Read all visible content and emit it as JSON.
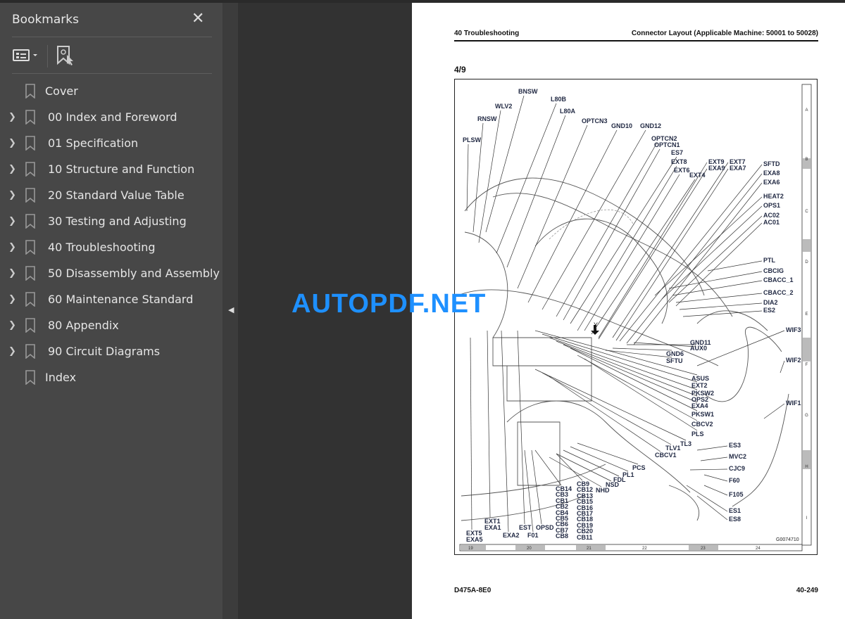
{
  "sidebar": {
    "title": "Bookmarks",
    "close_icon": "close-icon",
    "items": [
      {
        "label": "Cover",
        "expandable": false
      },
      {
        "label": "00 Index and Foreword",
        "expandable": true
      },
      {
        "label": "01 Specification",
        "expandable": true
      },
      {
        "label": "10 Structure and Function",
        "expandable": true
      },
      {
        "label": "20 Standard Value Table",
        "expandable": true
      },
      {
        "label": "30 Testing and Adjusting",
        "expandable": true
      },
      {
        "label": "40 Troubleshooting",
        "expandable": true
      },
      {
        "label": "50 Disassembly and Assembly",
        "expandable": true
      },
      {
        "label": "60 Maintenance Standard",
        "expandable": true
      },
      {
        "label": "80 Appendix",
        "expandable": true
      },
      {
        "label": "90 Circuit Diagrams",
        "expandable": true
      },
      {
        "label": "Index",
        "expandable": false
      }
    ]
  },
  "page": {
    "header_left": "40 Troubleshooting",
    "header_right": "Connector Layout (Applicable Machine: 50001 to 50028)",
    "page_fraction": "4/9",
    "figure_id": "G0074710",
    "view_marker": "Y",
    "footer_left": "D475A-8E0",
    "footer_right": "40-249",
    "grid_rows": [
      "A",
      "B",
      "C",
      "D",
      "E",
      "F",
      "G",
      "H",
      "I"
    ],
    "grid_cols": [
      "19",
      "20",
      "21",
      "22",
      "23",
      "24"
    ],
    "connector_labels": [
      "BNSW",
      "L80B",
      "WLV2",
      "L80A",
      "RNSW",
      "OPTCN3",
      "GND10",
      "GND12",
      "PLSW",
      "OPTCN2",
      "OPTCN1",
      "ES7",
      "EXT8",
      "EXT9",
      "EXT7",
      "SFTD",
      "EXA9",
      "EXA7",
      "EXT6",
      "EXT4",
      "EXA8",
      "EXA6",
      "HEAT2",
      "OPS1",
      "AC02",
      "AC01",
      "PTL",
      "CBCIG",
      "CBACC_1",
      "CBACC_2",
      "DIA2",
      "ES2",
      "WIF3",
      "GND11",
      "AUX0",
      "GND6",
      "SFTU",
      "WIF2",
      "ASUS",
      "EXT2",
      "PKSW2",
      "OPS2",
      "EXA4",
      "PKSW1",
      "WIF1",
      "CBCV2",
      "PLS",
      "TL3",
      "ES3",
      "TLV1",
      "CBCV1",
      "MVC2",
      "CJC9",
      "PCS",
      "PL1",
      "FDL",
      "F60",
      "NSD",
      "NHD",
      "F105",
      "ES1",
      "ES8",
      "CB14",
      "CB3",
      "CB1",
      "CB2",
      "CB4",
      "CB5",
      "CB6",
      "CB7",
      "CB8",
      "CB9",
      "CB12",
      "CB13",
      "CB15",
      "CB16",
      "CB17",
      "CB18",
      "CB19",
      "CB20",
      "CB11",
      "EXT1",
      "EXA1",
      "EST",
      "OPSD",
      "EXT5",
      "EXA5",
      "EXA2",
      "F01"
    ]
  },
  "watermark": "AUTOPDF.NET",
  "colors": {
    "watermark": "#1e90ff",
    "sidebar_bg": "#474747",
    "viewer_bg": "#323232"
  }
}
